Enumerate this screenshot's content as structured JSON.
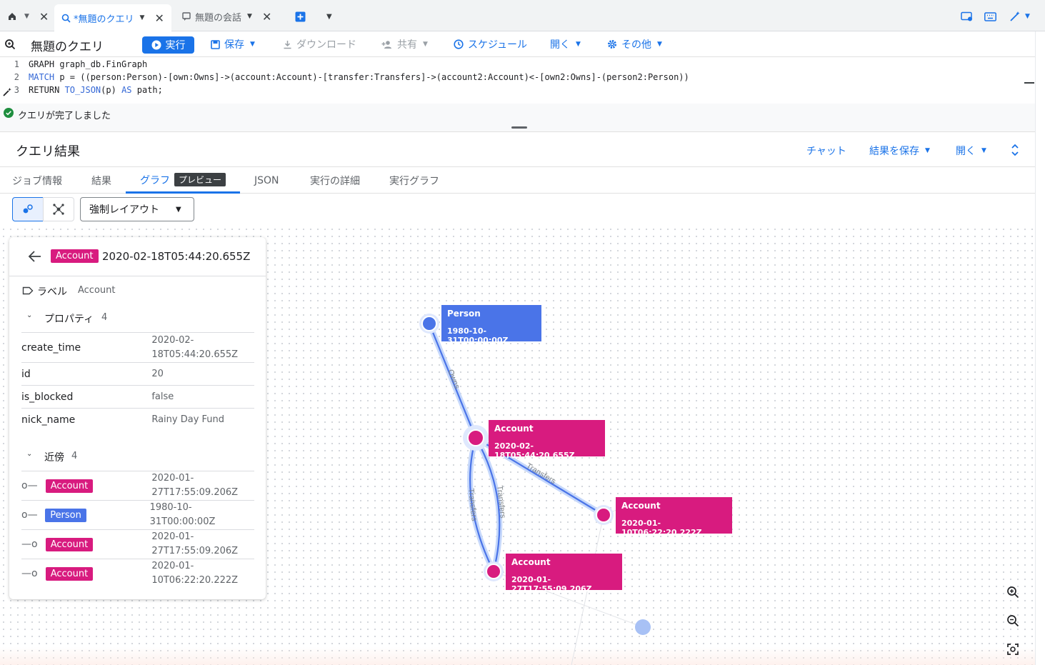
{
  "tabs": [
    {
      "label": "*無題のクエリ",
      "active": true
    },
    {
      "label": "無題の会話",
      "active": false
    }
  ],
  "toolbar": {
    "title": "無題のクエリ",
    "run": "実行",
    "save": "保存",
    "download": "ダウンロード",
    "share": "共有",
    "schedule": "スケジュール",
    "open": "開く",
    "more": "その他"
  },
  "editor": {
    "lines": [
      {
        "num": "1",
        "text": "GRAPH graph_db.FinGraph"
      },
      {
        "num": "2",
        "kw": "MATCH",
        "text": " p = ((person:Person)-[own:Owns]->(account:Account)-[transfer:Transfers]->(account2:Account)<-[own2:Owns]-(person2:Person))"
      },
      {
        "num": "3",
        "kw1": "RETURN ",
        "fn": "TO_JSON",
        "rest": "(p) ",
        "kw2": "AS",
        "end": " path;"
      }
    ]
  },
  "status": {
    "text": "クエリが完了しました"
  },
  "results": {
    "title": "クエリ結果",
    "chat": "チャット",
    "save_results": "結果を保存",
    "open": "開く",
    "tabs": [
      "ジョブ情報",
      "結果",
      "グラフ",
      "JSON",
      "実行の詳細",
      "実行グラフ"
    ],
    "preview": "プレビュー",
    "layout": "強制レイアウト"
  },
  "panel": {
    "label_tag": "Account",
    "title": "2020-02-18T05:44:20.655Z",
    "label_key": "ラベル",
    "label_value": "Account",
    "props_heading": "プロパティ",
    "props_count": "4",
    "properties": [
      {
        "key": "create_time",
        "value": "2020-02-18T05:44:20.655Z"
      },
      {
        "key": "id",
        "value": "20"
      },
      {
        "key": "is_blocked",
        "value": "false"
      },
      {
        "key": "nick_name",
        "value": "Rainy Day Fund"
      }
    ],
    "neighbors_heading": "近傍",
    "neighbors_count": "4",
    "neighbors": [
      {
        "dir": "out",
        "label": "Account",
        "value": "2020-01-27T17:55:09.206Z"
      },
      {
        "dir": "out",
        "label": "Person",
        "value": "1980-10-31T00:00:00Z"
      },
      {
        "dir": "in",
        "label": "Account",
        "value": "2020-01-27T17:55:09.206Z"
      },
      {
        "dir": "in",
        "label": "Account",
        "value": "2020-01-10T06:22:20.222Z"
      }
    ]
  },
  "graph": {
    "nodes": [
      {
        "label": "Person",
        "value": "1980-10-31T00:00:00Z",
        "color": "#4a74e8"
      },
      {
        "label": "Account",
        "value": "2020-02-18T05:44:20.655Z",
        "color": "#d81b7f"
      },
      {
        "label": "Account",
        "value": "2020-01-10T06:22:20.222Z",
        "color": "#d81b7f"
      },
      {
        "label": "Account",
        "value": "2020-01-27T17:55:09.206Z",
        "color": "#d81b7f"
      }
    ],
    "edges": {
      "owns": "Owns",
      "transfers": "Transfers"
    }
  },
  "colors": {
    "accent": "#1a73e8",
    "account": "#d81b7f",
    "person": "#4a74e8"
  }
}
